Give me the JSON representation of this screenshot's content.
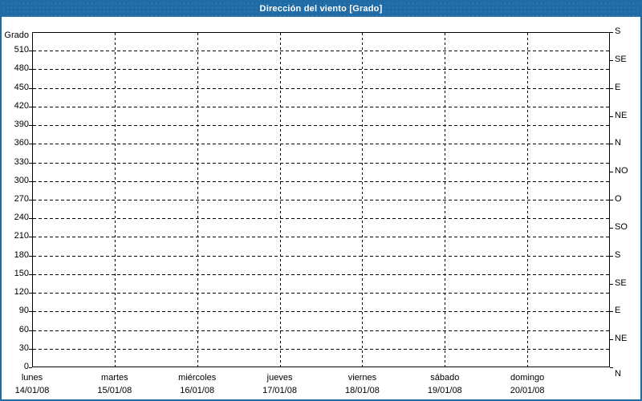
{
  "title": "Dirección del viento [Grado]",
  "colors": {
    "accent_blue": "#1e6ba6",
    "title_text": "#ffffff",
    "plot_border": "#000000",
    "grid": "#000000",
    "background": "#ffffff",
    "axis_text": "#000000"
  },
  "chart_data": {
    "type": "line",
    "title": "Dirección del viento [Grado]",
    "grid": true,
    "series": [],
    "y_axis_left": {
      "label": "Grado",
      "range": [
        0,
        540
      ],
      "tick_step": 30,
      "ticks": [
        0,
        30,
        60,
        90,
        120,
        150,
        180,
        210,
        240,
        270,
        300,
        330,
        360,
        390,
        420,
        450,
        480,
        510
      ]
    },
    "y_axis_right": {
      "tick_step": 45,
      "ticks": [
        {
          "value": 540,
          "label": "S"
        },
        {
          "value": 495,
          "label": "SE"
        },
        {
          "value": 450,
          "label": "E"
        },
        {
          "value": 405,
          "label": "NE"
        },
        {
          "value": 360,
          "label": "N"
        },
        {
          "value": 315,
          "label": "NO"
        },
        {
          "value": 270,
          "label": "O"
        },
        {
          "value": 225,
          "label": "SO"
        },
        {
          "value": 180,
          "label": "S"
        },
        {
          "value": 135,
          "label": "SE"
        },
        {
          "value": 90,
          "label": "E"
        },
        {
          "value": 45,
          "label": "NE"
        },
        {
          "value": 0,
          "label": "N"
        }
      ]
    },
    "x_axis": {
      "days": [
        {
          "name": "lunes",
          "date": "14/01/08"
        },
        {
          "name": "martes",
          "date": "15/01/08"
        },
        {
          "name": "miércoles",
          "date": "16/01/08"
        },
        {
          "name": "jueves",
          "date": "17/01/08"
        },
        {
          "name": "viernes",
          "date": "18/01/08"
        },
        {
          "name": "sábado",
          "date": "19/01/08"
        },
        {
          "name": "domingo",
          "date": "20/01/08"
        }
      ]
    }
  }
}
